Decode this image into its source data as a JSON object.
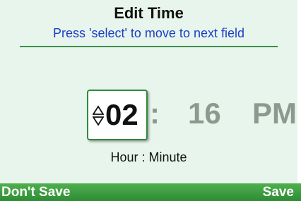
{
  "header": {
    "title": "Edit Time",
    "instruction": "Press 'select' to move to next field"
  },
  "time": {
    "hour": "02",
    "separator": ":",
    "minute": "16",
    "ampm": "PM",
    "hour_icon": "up-down-arrows-icon"
  },
  "hint": "Hour : Minute",
  "softkeys": {
    "left_label": "Don't Save",
    "right_label": "Save"
  },
  "colors": {
    "panel_background": "#e8f5ec",
    "accent_green": "#2e8b34",
    "instruction_blue": "#1a3ec8",
    "inactive_field": "#8a9a8e"
  }
}
